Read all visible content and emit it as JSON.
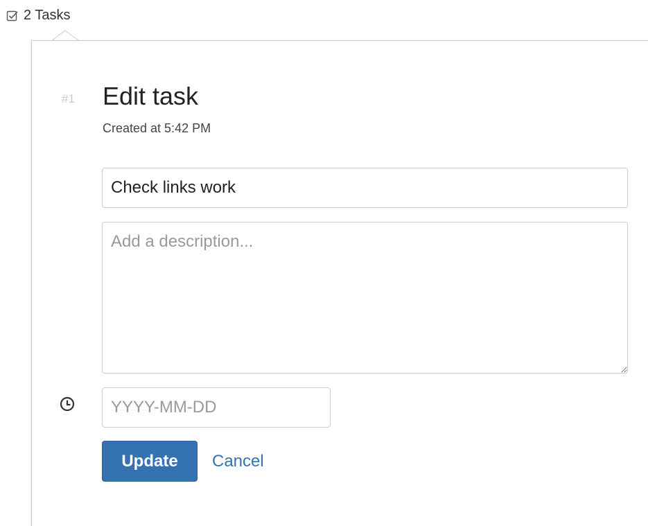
{
  "tasks_toggle": {
    "label": "2 Tasks",
    "icon": "checkbox-icon"
  },
  "task": {
    "number": "#1",
    "title": "Edit task",
    "created": "Created at 5:42 PM"
  },
  "form": {
    "title_value": "Check links work",
    "description_placeholder": "Add a description...",
    "description_value": "",
    "date_placeholder": "YYYY-MM-DD",
    "date_value": "",
    "date_icon": "clock-icon"
  },
  "actions": {
    "update_label": "Update",
    "cancel_label": "Cancel"
  },
  "colors": {
    "accent": "#3572b0",
    "muted": "#c8c8c8",
    "border": "#cccccc"
  }
}
